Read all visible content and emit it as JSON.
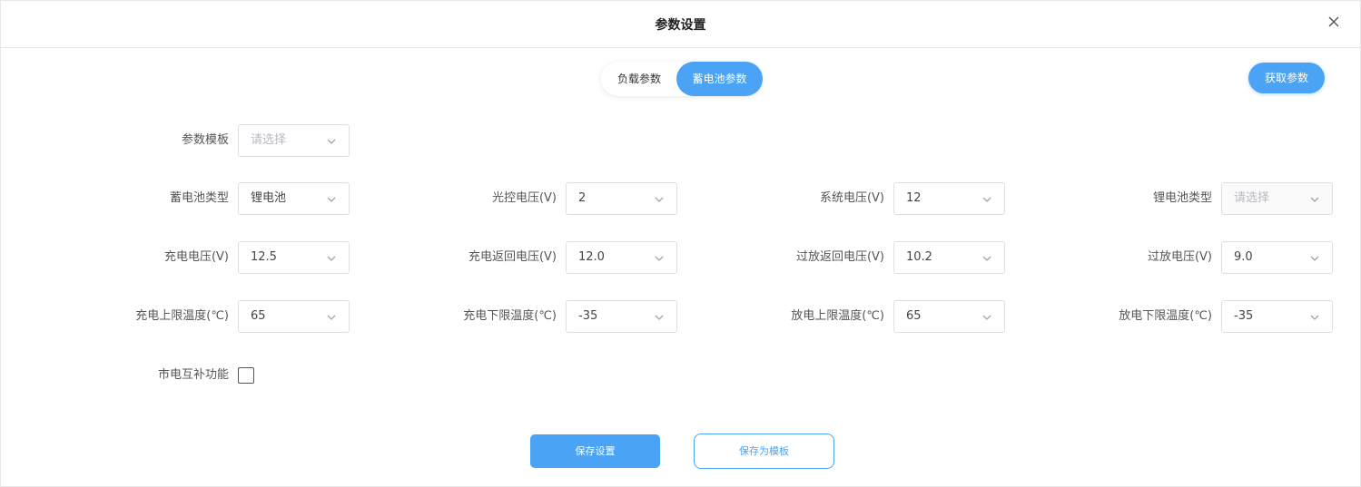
{
  "dialog": {
    "title": "参数设置",
    "close_icon": "close-icon"
  },
  "tabs": [
    {
      "label": "负载参数",
      "active": false
    },
    {
      "label": "蓄电池参数",
      "active": true
    }
  ],
  "fetch_button": "获取参数",
  "template": {
    "label": "参数模板",
    "value": "请选择",
    "placeholder": true
  },
  "fields": [
    {
      "label": "蓄电池类型",
      "value": "锂电池",
      "placeholder": false
    },
    {
      "label": "光控电压(V)",
      "value": "2",
      "placeholder": false
    },
    {
      "label": "系统电压(V)",
      "value": "12",
      "placeholder": false
    },
    {
      "label": "锂电池类型",
      "value": "请选择",
      "placeholder": true
    },
    {
      "label": "充电电压(V)",
      "value": "12.5",
      "placeholder": false
    },
    {
      "label": "充电返回电压(V)",
      "value": "12.0",
      "placeholder": false
    },
    {
      "label": "过放返回电压(V)",
      "value": "10.2",
      "placeholder": false
    },
    {
      "label": "过放电压(V)",
      "value": "9.0",
      "placeholder": false
    },
    {
      "label": "充电上限温度(℃)",
      "value": "65",
      "placeholder": false
    },
    {
      "label": "充电下限温度(℃)",
      "value": "-35",
      "placeholder": false
    },
    {
      "label": "放电上限温度(℃)",
      "value": "65",
      "placeholder": false
    },
    {
      "label": "放电下限温度(℃)",
      "value": "-35",
      "placeholder": false
    }
  ],
  "mains_complement": {
    "label": "市电互补功能",
    "checked": false
  },
  "buttons": {
    "save": "保存设置",
    "save_template": "保存为模板"
  },
  "colors": {
    "accent": "#4aa3f5",
    "placeholder": "#b6b9bf",
    "border": "#dcdfe6"
  }
}
